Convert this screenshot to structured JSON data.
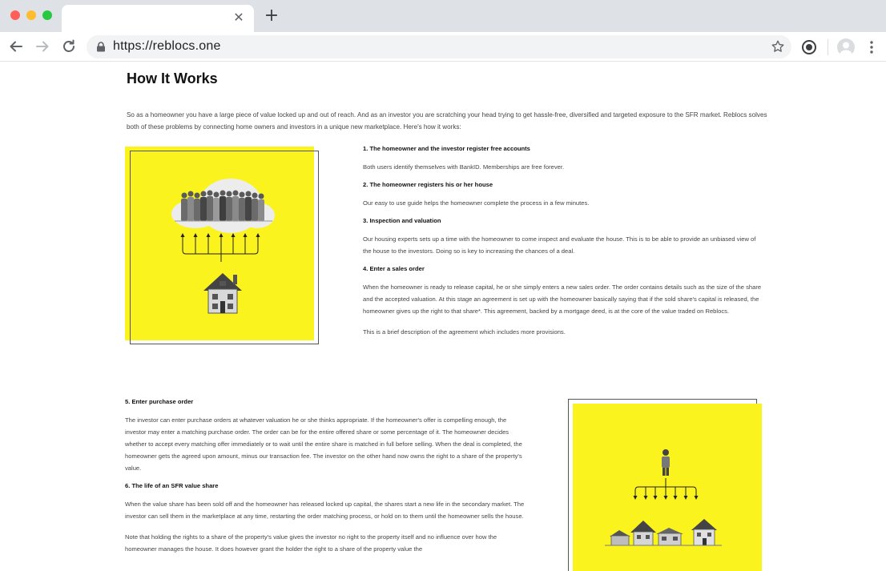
{
  "browser": {
    "tab_close": "✕",
    "new_tab": "+",
    "url": "https://reblocs.one"
  },
  "page": {
    "heading": "How It Works",
    "intro": "So as a homeowner you have a large piece of value locked up and out of reach. And as an investor you are scratching your head trying to get hassle-free, diversified and targeted exposure to the SFR market. Reblocs solves both of these problems by connecting home owners and investors in a unique new marketplace. Here's how it works:",
    "steps": [
      {
        "title": "1. The homeowner and the investor register free accounts",
        "body": "Both users identify themselves with BankID. Memberships are free forever."
      },
      {
        "title": "2. The homeowner registers his or her house",
        "body": "Our easy to use guide helps the homeowner complete the process in a few minutes."
      },
      {
        "title": "3. Inspection and valuation",
        "body": "Our housing experts sets up a time with the homeowner to come inspect and evaluate the house. This is to be able to provide an unbiased view of the house to the investors. Doing so is key to increasing the chances of a deal."
      },
      {
        "title": "4. Enter a sales order",
        "body": "When the homeowner is ready to release capital, he or she simply enters a new sales order. The order contains details such as the size of the share and the accepted valuation. At this stage an agreement is set up with the homeowner basically saying that if the sold share's capital is released, the homeowner gives up the right to that share*. This agreement, backed by a mortgage deed, is at the core of the value traded on Reblocs."
      }
    ],
    "footnote": "This is a brief description of the agreement which includes more provisions.",
    "steps2": [
      {
        "title": "5. Enter purchase order",
        "body": "The investor can enter purchase orders at whatever valuation he or she thinks appropriate. If the homeowner's offer is compelling enough, the investor may enter a matching purchase order. The order can be for the entire offered share or some percentage of it. The homeowner decides whether to accept every matching offer immediately or to wait until the entire share is matched in full before selling. When the deal is completed, the homeowner gets the agreed upon amount, minus our transaction fee. The investor on the other hand now owns the right to a share of the property's value."
      },
      {
        "title": "6. The life of an SFR value share",
        "body": "When the value share has been sold off and the homeowner has released locked up capital, the shares start a new life in the secondary market. The investor can sell them in the marketplace at any time, restarting the order matching process, or hold on to them until the homeowner sells the house."
      }
    ],
    "note": "Note that holding the rights to a share of the property's value gives the investor no right to the property itself and no influence over how the homeowner manages the house. It does however grant the holder the right to a share of the property value the",
    "colors": {
      "accent_yellow": "#fbf31e"
    }
  }
}
